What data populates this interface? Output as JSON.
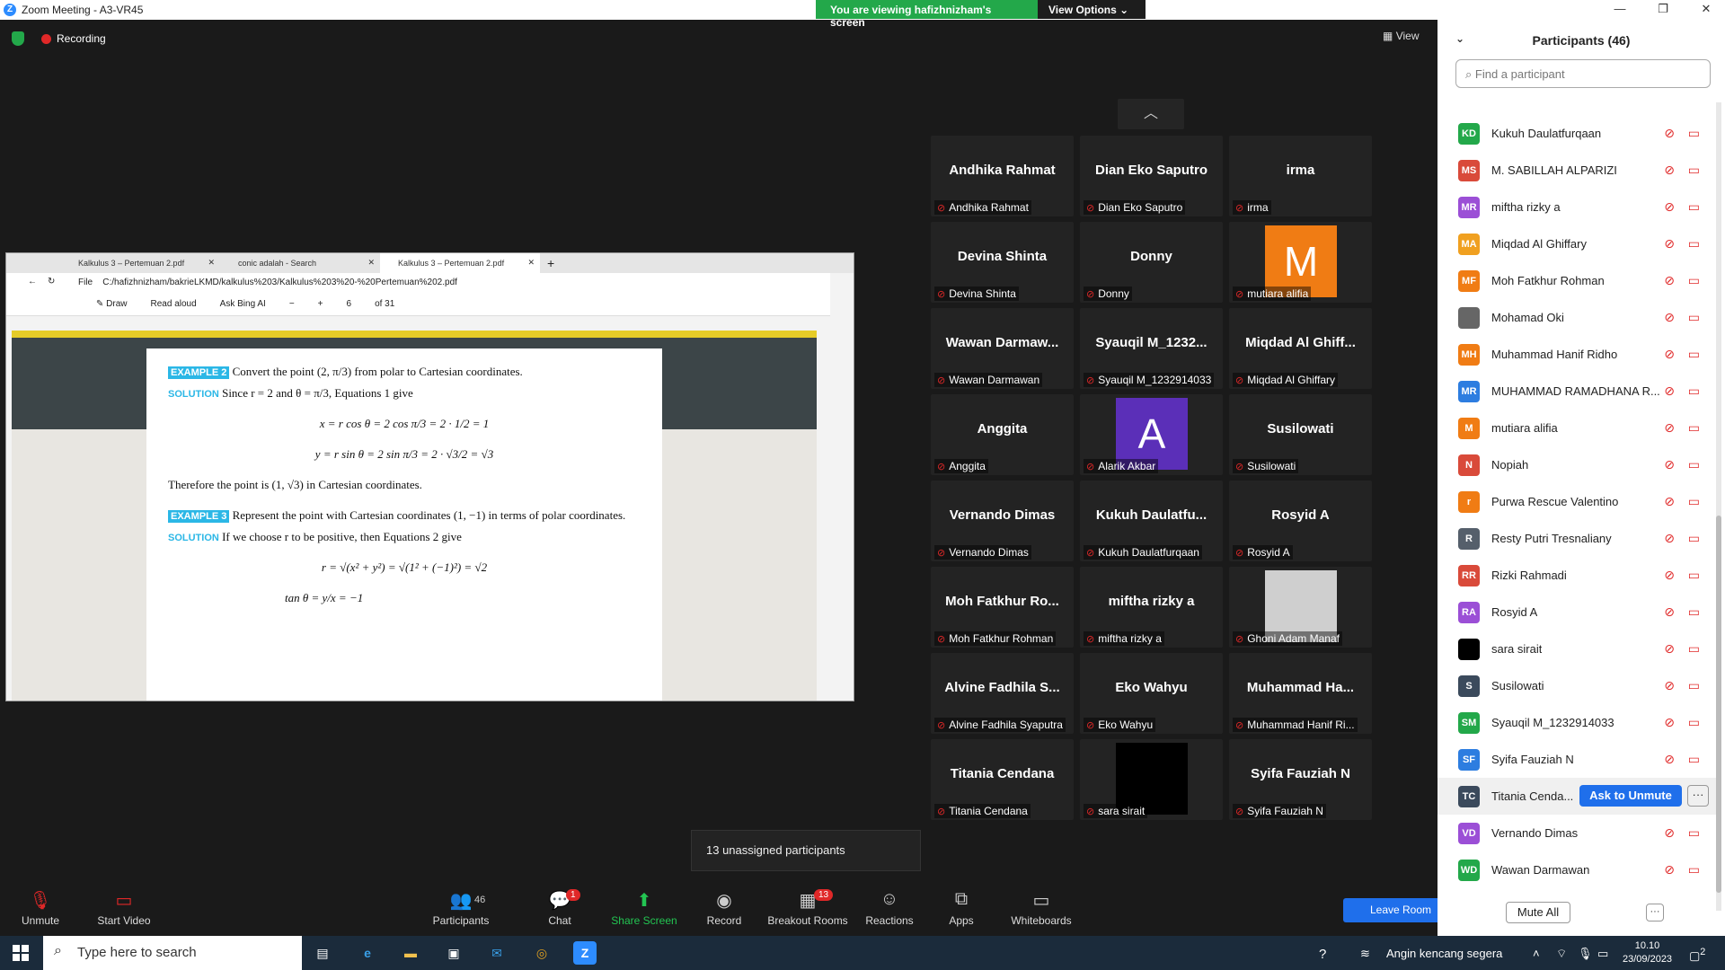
{
  "window": {
    "title": "Zoom Meeting - A3-VR45",
    "app_logo": "Z"
  },
  "share_banner": {
    "text": "You are viewing hafizhnizham's screen",
    "view_options": "View Options"
  },
  "status": {
    "recording": "Recording",
    "view": "View"
  },
  "shared_screen": {
    "tabs": [
      "Kalkulus 3 – Pertemuan 2.pdf",
      "conic adalah - Search",
      "Kalkulus 3 – Pertemuan 2.pdf"
    ],
    "address_prefix": "File",
    "address": "C:/hafizhnizham/bakrieLKMD/kalkulus%203/Kalkulus%203%20-%20Pertemuan%202.pdf",
    "toolbar": {
      "draw": "Draw",
      "read_aloud": "Read aloud",
      "ask_bing": "Ask Bing AI",
      "page": "6",
      "of_pages": "of 31"
    },
    "pdf": {
      "ex2_label": "EXAMPLE 2",
      "ex2_text": "Convert the point (2, π/3) from polar to Cartesian coordinates.",
      "solution_label": "SOLUTION",
      "sol2_text": "Since r = 2 and θ = π/3, Equations 1 give",
      "eq1": "x = r cos θ = 2 cos π/3 = 2 · 1/2 = 1",
      "eq2": "y = r sin θ = 2 sin π/3 = 2 · √3/2 = √3",
      "therefore": "Therefore the point is (1, √3) in Cartesian coordinates.",
      "ex3_label": "EXAMPLE 3",
      "ex3_text": "Represent the point with Cartesian coordinates (1, −1) in terms of polar coordinates.",
      "sol3_text": "If we choose r to be positive, then Equations 2 give",
      "eq3": "r = √(x² + y²) = √(1² + (−1)²) = √2",
      "eq4": "tan θ = y/x = −1"
    }
  },
  "video_tiles": [
    {
      "big": "Andhika Rahmat",
      "small": "Andhika Rahmat"
    },
    {
      "big": "Dian Eko Saputro",
      "small": "Dian Eko Saputro"
    },
    {
      "big": "irma",
      "small": "irma"
    },
    {
      "big": "Devina Shinta",
      "small": "Devina Shinta"
    },
    {
      "big": "Donny",
      "small": "Donny"
    },
    {
      "big": "",
      "small": "mutiara alifia",
      "avatar": "M",
      "avatar_color": "#f07c14"
    },
    {
      "big": "Wawan Darmaw...",
      "small": "Wawan Darmawan"
    },
    {
      "big": "Syauqil M_1232...",
      "small": "Syauqil M_1232914033"
    },
    {
      "big": "Miqdad Al Ghiff...",
      "small": "Miqdad Al Ghiffary"
    },
    {
      "big": "Anggita",
      "small": "Anggita"
    },
    {
      "big": "",
      "small": "Alarik Akbar",
      "avatar": "A",
      "avatar_color": "#5b2fb8"
    },
    {
      "big": "Susilowati",
      "small": "Susilowati"
    },
    {
      "big": "Vernando Dimas",
      "small": "Vernando Dimas"
    },
    {
      "big": "Kukuh Daulatfu...",
      "small": "Kukuh Daulatfurqaan"
    },
    {
      "big": "Rosyid A",
      "small": "Rosyid A"
    },
    {
      "big": "Moh Fatkhur Ro...",
      "small": "Moh Fatkhur Rohman"
    },
    {
      "big": "miftha rizky a",
      "small": "miftha rizky a"
    },
    {
      "big": "",
      "small": "Ghoni Adam Manaf",
      "avatar": "",
      "avatar_color": "#cfcfcf"
    },
    {
      "big": "Alvine Fadhila S...",
      "small": "Alvine Fadhila Syaputra"
    },
    {
      "big": "Eko Wahyu",
      "small": "Eko Wahyu"
    },
    {
      "big": "Muhammad Ha...",
      "small": "Muhammad Hanif Ri..."
    },
    {
      "big": "Titania Cendana",
      "small": "Titania Cendana"
    },
    {
      "big": "",
      "small": "sara sirait",
      "avatar": "",
      "avatar_color": "#000000"
    },
    {
      "big": "Syifa Fauziah N",
      "small": "Syifa Fauziah N"
    }
  ],
  "unassigned": "13 unassigned participants",
  "toolbar": {
    "unmute": "Unmute",
    "start_video": "Start Video",
    "participants": "Participants",
    "participants_count": "46",
    "chat": "Chat",
    "chat_badge": "1",
    "share_screen": "Share Screen",
    "record": "Record",
    "breakout": "Breakout Rooms",
    "breakout_badge": "13",
    "reactions": "Reactions",
    "apps": "Apps",
    "whiteboards": "Whiteboards",
    "leave": "Leave Room"
  },
  "panel": {
    "title": "Participants (46)",
    "search_placeholder": "Find a participant",
    "mute_all": "Mute All",
    "more": "···",
    "participants": [
      {
        "initials": "KD",
        "name": "Kukuh Daulatfurqaan",
        "color": "#23a84a"
      },
      {
        "initials": "MS",
        "name": "M. SABILLAH ALPARIZI",
        "color": "#d94a3a"
      },
      {
        "initials": "MR",
        "name": "miftha rizky a",
        "color": "#9b4fd6"
      },
      {
        "initials": "MA",
        "name": "Miqdad Al Ghiffary",
        "color": "#f0a020"
      },
      {
        "initials": "MF",
        "name": "Moh Fatkhur Rohman",
        "color": "#f07c14"
      },
      {
        "initials": "",
        "name": "Mohamad Oki",
        "color": "#666666"
      },
      {
        "initials": "MH",
        "name": "Muhammad Hanif Ridho",
        "color": "#f07c14"
      },
      {
        "initials": "MR",
        "name": "MUHAMMAD RAMADHANA R...",
        "color": "#2d7de0"
      },
      {
        "initials": "M",
        "name": "mutiara alifia",
        "color": "#f07c14"
      },
      {
        "initials": "N",
        "name": "Nopiah",
        "color": "#d94a3a"
      },
      {
        "initials": "r",
        "name": "Purwa Rescue Valentino",
        "color": "#f07c14"
      },
      {
        "initials": "R",
        "name": "Resty Putri Tresnaliany",
        "color": "#555f6b"
      },
      {
        "initials": "RR",
        "name": "Rizki Rahmadi",
        "color": "#d94a3a"
      },
      {
        "initials": "RA",
        "name": "Rosyid A",
        "color": "#9b4fd6"
      },
      {
        "initials": "",
        "name": "sara sirait",
        "color": "#000000"
      },
      {
        "initials": "S",
        "name": "Susilowati",
        "color": "#3b4a5c"
      },
      {
        "initials": "SM",
        "name": "Syauqil M_1232914033",
        "color": "#23a84a"
      },
      {
        "initials": "SF",
        "name": "Syifa Fauziah N",
        "color": "#2d7de0"
      },
      {
        "initials": "TC",
        "name": "Titania Cenda...",
        "color": "#3b4a5c",
        "highlight": true,
        "ask": "Ask to Unmute",
        "more": "···"
      },
      {
        "initials": "VD",
        "name": "Vernando Dimas",
        "color": "#9b4fd6"
      },
      {
        "initials": "WD",
        "name": "Wawan Darmawan",
        "color": "#23a84a"
      }
    ]
  },
  "taskbar": {
    "search": "Type here to search",
    "weather": "Angin kencang segera",
    "time": "10.10",
    "date": "23/09/2023",
    "notifications": "2"
  }
}
